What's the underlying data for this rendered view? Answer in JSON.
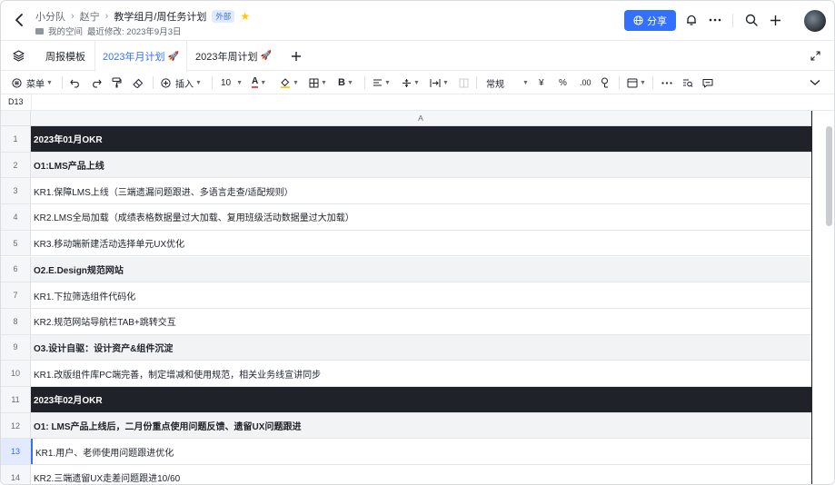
{
  "header": {
    "back_icon": "chevron-left-icon",
    "breadcrumbs": [
      "小分队",
      "赵宁",
      "教学组月/周任务计划"
    ],
    "tag": "外部",
    "sub_location": "我的空间",
    "last_modified": "最近修改: 2023年9月3日",
    "share_label": "分享"
  },
  "tabs": [
    {
      "label": "周报模板"
    },
    {
      "label": "2023年月计划",
      "emoji": "🚀"
    },
    {
      "label": "2023年周计划",
      "emoji": "🚀"
    }
  ],
  "toolbar": {
    "menu_label": "菜单",
    "insert_label": "插入",
    "font_size": "10",
    "format_label": "常规",
    "currency": "¥",
    "percent": "%",
    "decimals": ".00"
  },
  "formula_bar": {
    "cell_ref": "D13"
  },
  "grid": {
    "column_header": "A",
    "selected_row": 13,
    "rows": [
      {
        "num": "1",
        "text": "2023年01月OKR",
        "style": "dark"
      },
      {
        "num": "2",
        "text": "O1:LMS产品上线",
        "style": "gray"
      },
      {
        "num": "3",
        "text": "KR1.保障LMS上线（三端遗漏问题跟进、多语言走查/适配规则）",
        "style": "normal"
      },
      {
        "num": "4",
        "text": "KR2.LMS全局加载（成绩表格数据量过大加载、复用班级活动数据量过大加载）",
        "style": "normal"
      },
      {
        "num": "5",
        "text": "KR3.移动端新建活动选择单元UX优化",
        "style": "normal"
      },
      {
        "num": "6",
        "text": "O2.E.Design规范网站",
        "style": "gray"
      },
      {
        "num": "7",
        "text": "KR1.下拉筛选组件代码化",
        "style": "normal"
      },
      {
        "num": "8",
        "text": "KR2.规范网站导航栏TAB+跳转交互",
        "style": "normal"
      },
      {
        "num": "9",
        "text": "O3.设计自驱：设计资产&组件沉淀",
        "style": "gray"
      },
      {
        "num": "10",
        "text": "KR1.改版组件库PC端完善，制定增减和使用规范，相关业务线宣讲同步",
        "style": "normal"
      },
      {
        "num": "11",
        "text": "2023年02月OKR",
        "style": "dark"
      },
      {
        "num": "12",
        "text": "O1: LMS产品上线后，二月份重点使用问题反馈、遗留UX问题跟进",
        "style": "gray"
      },
      {
        "num": "13",
        "text": "KR1.用户、老师使用问题跟进优化",
        "style": "normal"
      },
      {
        "num": "14",
        "text": "KR2.三端遗留UX走差问题跟进10/60",
        "style": "normal"
      }
    ]
  }
}
